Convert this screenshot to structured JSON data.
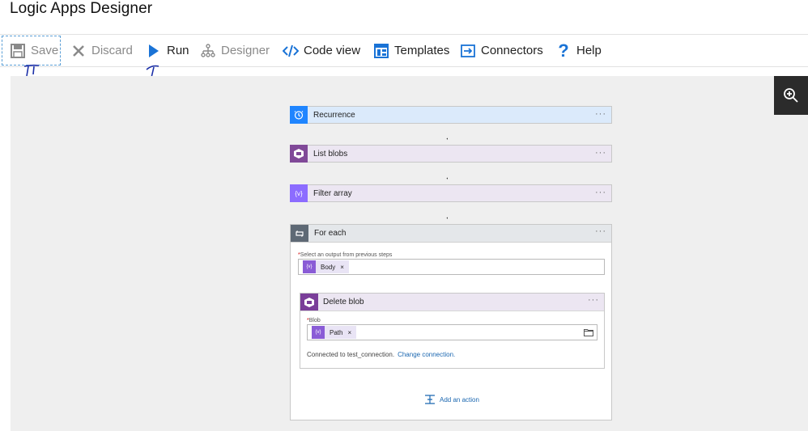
{
  "app": {
    "title": "Logic Apps Designer"
  },
  "toolbar": {
    "save": "Save",
    "discard": "Discard",
    "run": "Run",
    "designer": "Designer",
    "code_view": "Code view",
    "templates": "Templates",
    "connectors": "Connectors",
    "help": "Help"
  },
  "flow": {
    "steps": [
      {
        "label": "Recurrence",
        "icon": "clock-icon",
        "color": "#1f85ff"
      },
      {
        "label": "List blobs",
        "icon": "blob-storage-icon",
        "color": "#804998"
      },
      {
        "label": "Filter array",
        "icon": "data-operations-icon",
        "color": "#8c6cff"
      }
    ],
    "foreach": {
      "label": "For each",
      "select_label": "Select an output from previous steps",
      "token": "Body",
      "inner": {
        "label": "Delete blob",
        "blob_label": "Blob",
        "token": "Path",
        "connected_text": "Connected to test_connection.",
        "change_link": "Change connection."
      },
      "add_action": "Add an action"
    },
    "more": "···"
  },
  "colors": {
    "recurrence_bg": "#dbeafb",
    "action_bg": "#ece6f2",
    "accent": "#1b67b0"
  }
}
